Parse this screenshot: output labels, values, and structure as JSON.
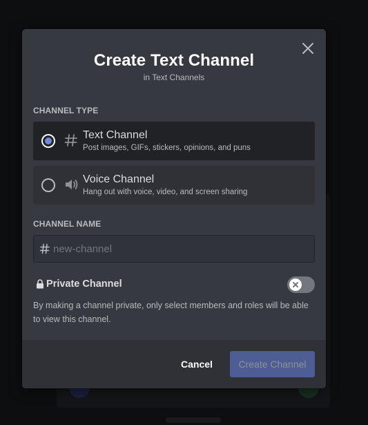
{
  "dialog": {
    "title": "Create Text Channel",
    "subtitle": "in Text Channels"
  },
  "channel_type": {
    "label": "CHANNEL TYPE",
    "options": [
      {
        "title": "Text Channel",
        "description": "Post images, GIFs, stickers, opinions, and puns",
        "icon": "hash-icon",
        "selected": true
      },
      {
        "title": "Voice Channel",
        "description": "Hang out with voice, video, and screen sharing",
        "icon": "speaker-icon",
        "selected": false
      }
    ]
  },
  "channel_name": {
    "label": "CHANNEL NAME",
    "value": "",
    "placeholder": "new-channel"
  },
  "private_channel": {
    "label": "Private Channel",
    "enabled": false,
    "description": "By making a channel private, only select members and roles will be able to view this channel."
  },
  "footer": {
    "cancel_label": "Cancel",
    "create_label": "Create Channel"
  },
  "colors": {
    "modal_bg": "#36393f",
    "footer_bg": "#2f3136",
    "selected_option_bg": "#202225",
    "accent": "#7289da",
    "create_button_disabled": "#4e5d94"
  }
}
